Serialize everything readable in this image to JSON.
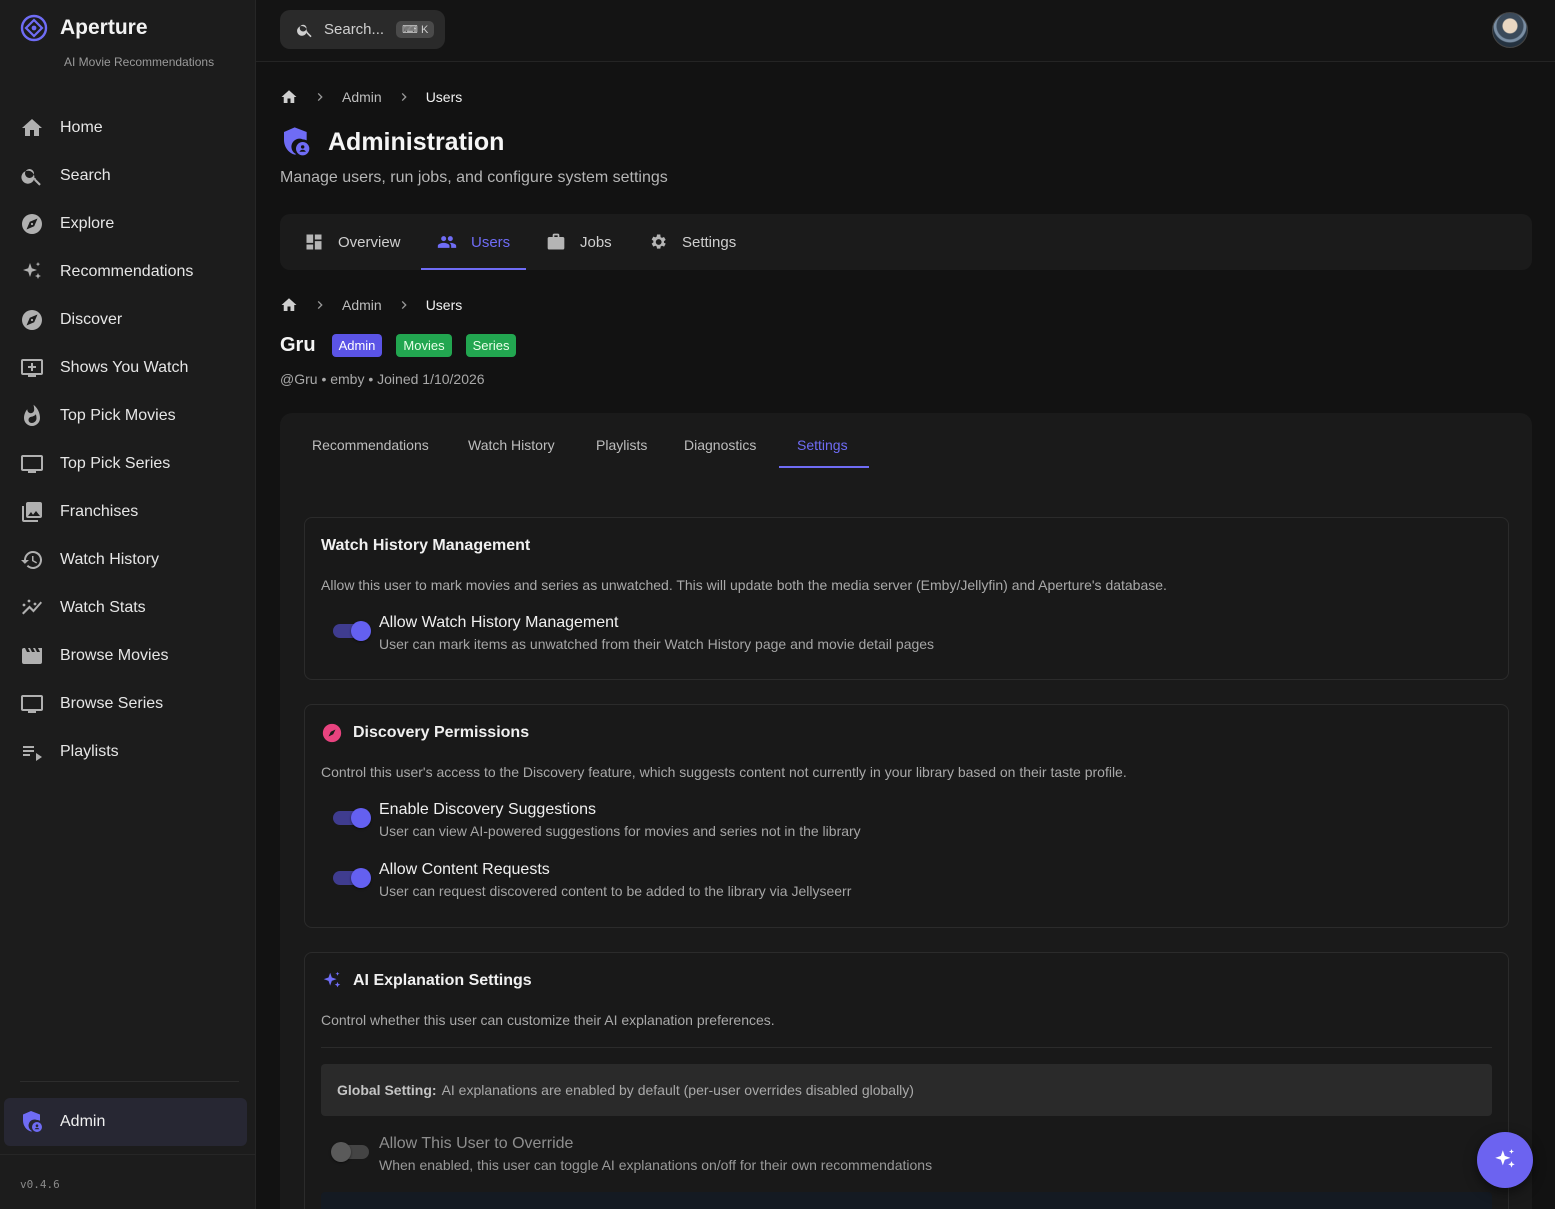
{
  "app": {
    "name": "Aperture",
    "subtitle": "AI Movie Recommendations",
    "version": "v0.4.6",
    "accent": "#6f6cf5"
  },
  "sidebar": {
    "items": [
      {
        "label": "Home",
        "icon": "home-icon"
      },
      {
        "label": "Search",
        "icon": "search-icon"
      },
      {
        "label": "Explore",
        "icon": "compass-icon"
      },
      {
        "label": "Recommendations",
        "icon": "sparkles-icon"
      },
      {
        "label": "Discover",
        "icon": "compass-icon"
      },
      {
        "label": "Shows You Watch",
        "icon": "tv-add-icon"
      },
      {
        "label": "Top Pick Movies",
        "icon": "flame-icon"
      },
      {
        "label": "Top Pick Series",
        "icon": "tv-icon"
      },
      {
        "label": "Franchises",
        "icon": "photo-library-icon"
      },
      {
        "label": "Watch History",
        "icon": "history-icon"
      },
      {
        "label": "Watch Stats",
        "icon": "stats-icon"
      },
      {
        "label": "Browse Movies",
        "icon": "film-icon"
      },
      {
        "label": "Browse Series",
        "icon": "tv-icon"
      },
      {
        "label": "Playlists",
        "icon": "playlist-icon"
      }
    ],
    "admin_label": "Admin"
  },
  "topbar": {
    "search_placeholder": "Search...",
    "search_shortcut": "⌨ K"
  },
  "breadcrumb": {
    "items": [
      "Admin",
      "Users"
    ]
  },
  "page": {
    "title": "Administration",
    "subtitle": "Manage users, run jobs, and configure system settings"
  },
  "main_tabs": [
    {
      "label": "Overview",
      "active": false
    },
    {
      "label": "Users",
      "active": true
    },
    {
      "label": "Jobs",
      "active": false
    },
    {
      "label": "Settings",
      "active": false
    }
  ],
  "user": {
    "name": "Gru",
    "badges": [
      "Admin",
      "Movies",
      "Series"
    ],
    "meta": "@Gru • emby • Joined 1/10/2026"
  },
  "user_tabs": [
    {
      "label": "Recommendations",
      "active": false
    },
    {
      "label": "Watch History",
      "active": false
    },
    {
      "label": "Playlists",
      "active": false
    },
    {
      "label": "Diagnostics",
      "active": false
    },
    {
      "label": "Settings",
      "active": true
    }
  ],
  "watch_history_card": {
    "title": "Watch History Management",
    "description": "Allow this user to mark movies and series as unwatched. This will update both the media server (Emby/Jellyfin) and Aperture's database.",
    "toggles": [
      {
        "label": "Allow Watch History Management",
        "help": "User can mark items as unwatched from their Watch History page and movie detail pages",
        "on": true
      }
    ]
  },
  "discovery_card": {
    "title": "Discovery Permissions",
    "description": "Control this user's access to the Discovery feature, which suggests content not currently in your library based on their taste profile.",
    "toggles": [
      {
        "label": "Enable Discovery Suggestions",
        "help": "User can view AI-powered suggestions for movies and series not in the library",
        "on": true
      },
      {
        "label": "Allow Content Requests",
        "help": "User can request discovered content to be added to the library via Jellyseerr",
        "on": true
      }
    ]
  },
  "ai_card": {
    "title": "AI Explanation Settings",
    "description": "Control whether this user can customize their AI explanation preferences.",
    "global_label": "Global Setting:",
    "global_text": "AI explanations are enabled by default (per-user overrides disabled globally)",
    "toggles": [
      {
        "label": "Allow This User to Override",
        "help": "When enabled, this user can toggle AI explanations on/off for their own recommendations",
        "on": false
      }
    ]
  }
}
